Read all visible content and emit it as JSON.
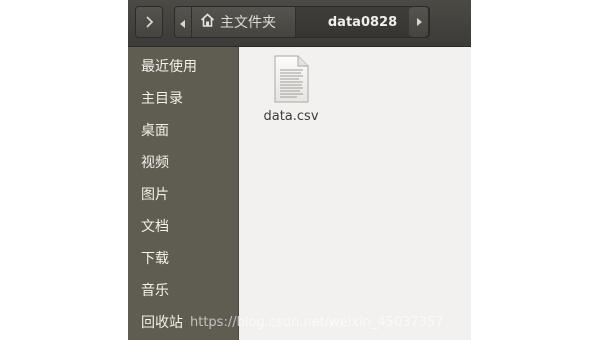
{
  "toolbar": {
    "path": {
      "home_label": "主文件夹",
      "current_folder": "data0828"
    }
  },
  "sidebar": {
    "items": [
      {
        "label": "最近使用"
      },
      {
        "label": "主目录"
      },
      {
        "label": "桌面"
      },
      {
        "label": "视频"
      },
      {
        "label": "图片"
      },
      {
        "label": "文档"
      },
      {
        "label": "下载"
      },
      {
        "label": "音乐"
      },
      {
        "label": "回收站"
      }
    ]
  },
  "content": {
    "files": [
      {
        "name": "data.csv",
        "icon": "text-file-icon"
      }
    ]
  },
  "watermark": "https://blog.csdn.net/weixin_45037357",
  "colors": {
    "sidebar_bg": "#5f5c52",
    "content_bg": "#f2f1f0",
    "toolbar_bg": "#3c3b37"
  }
}
